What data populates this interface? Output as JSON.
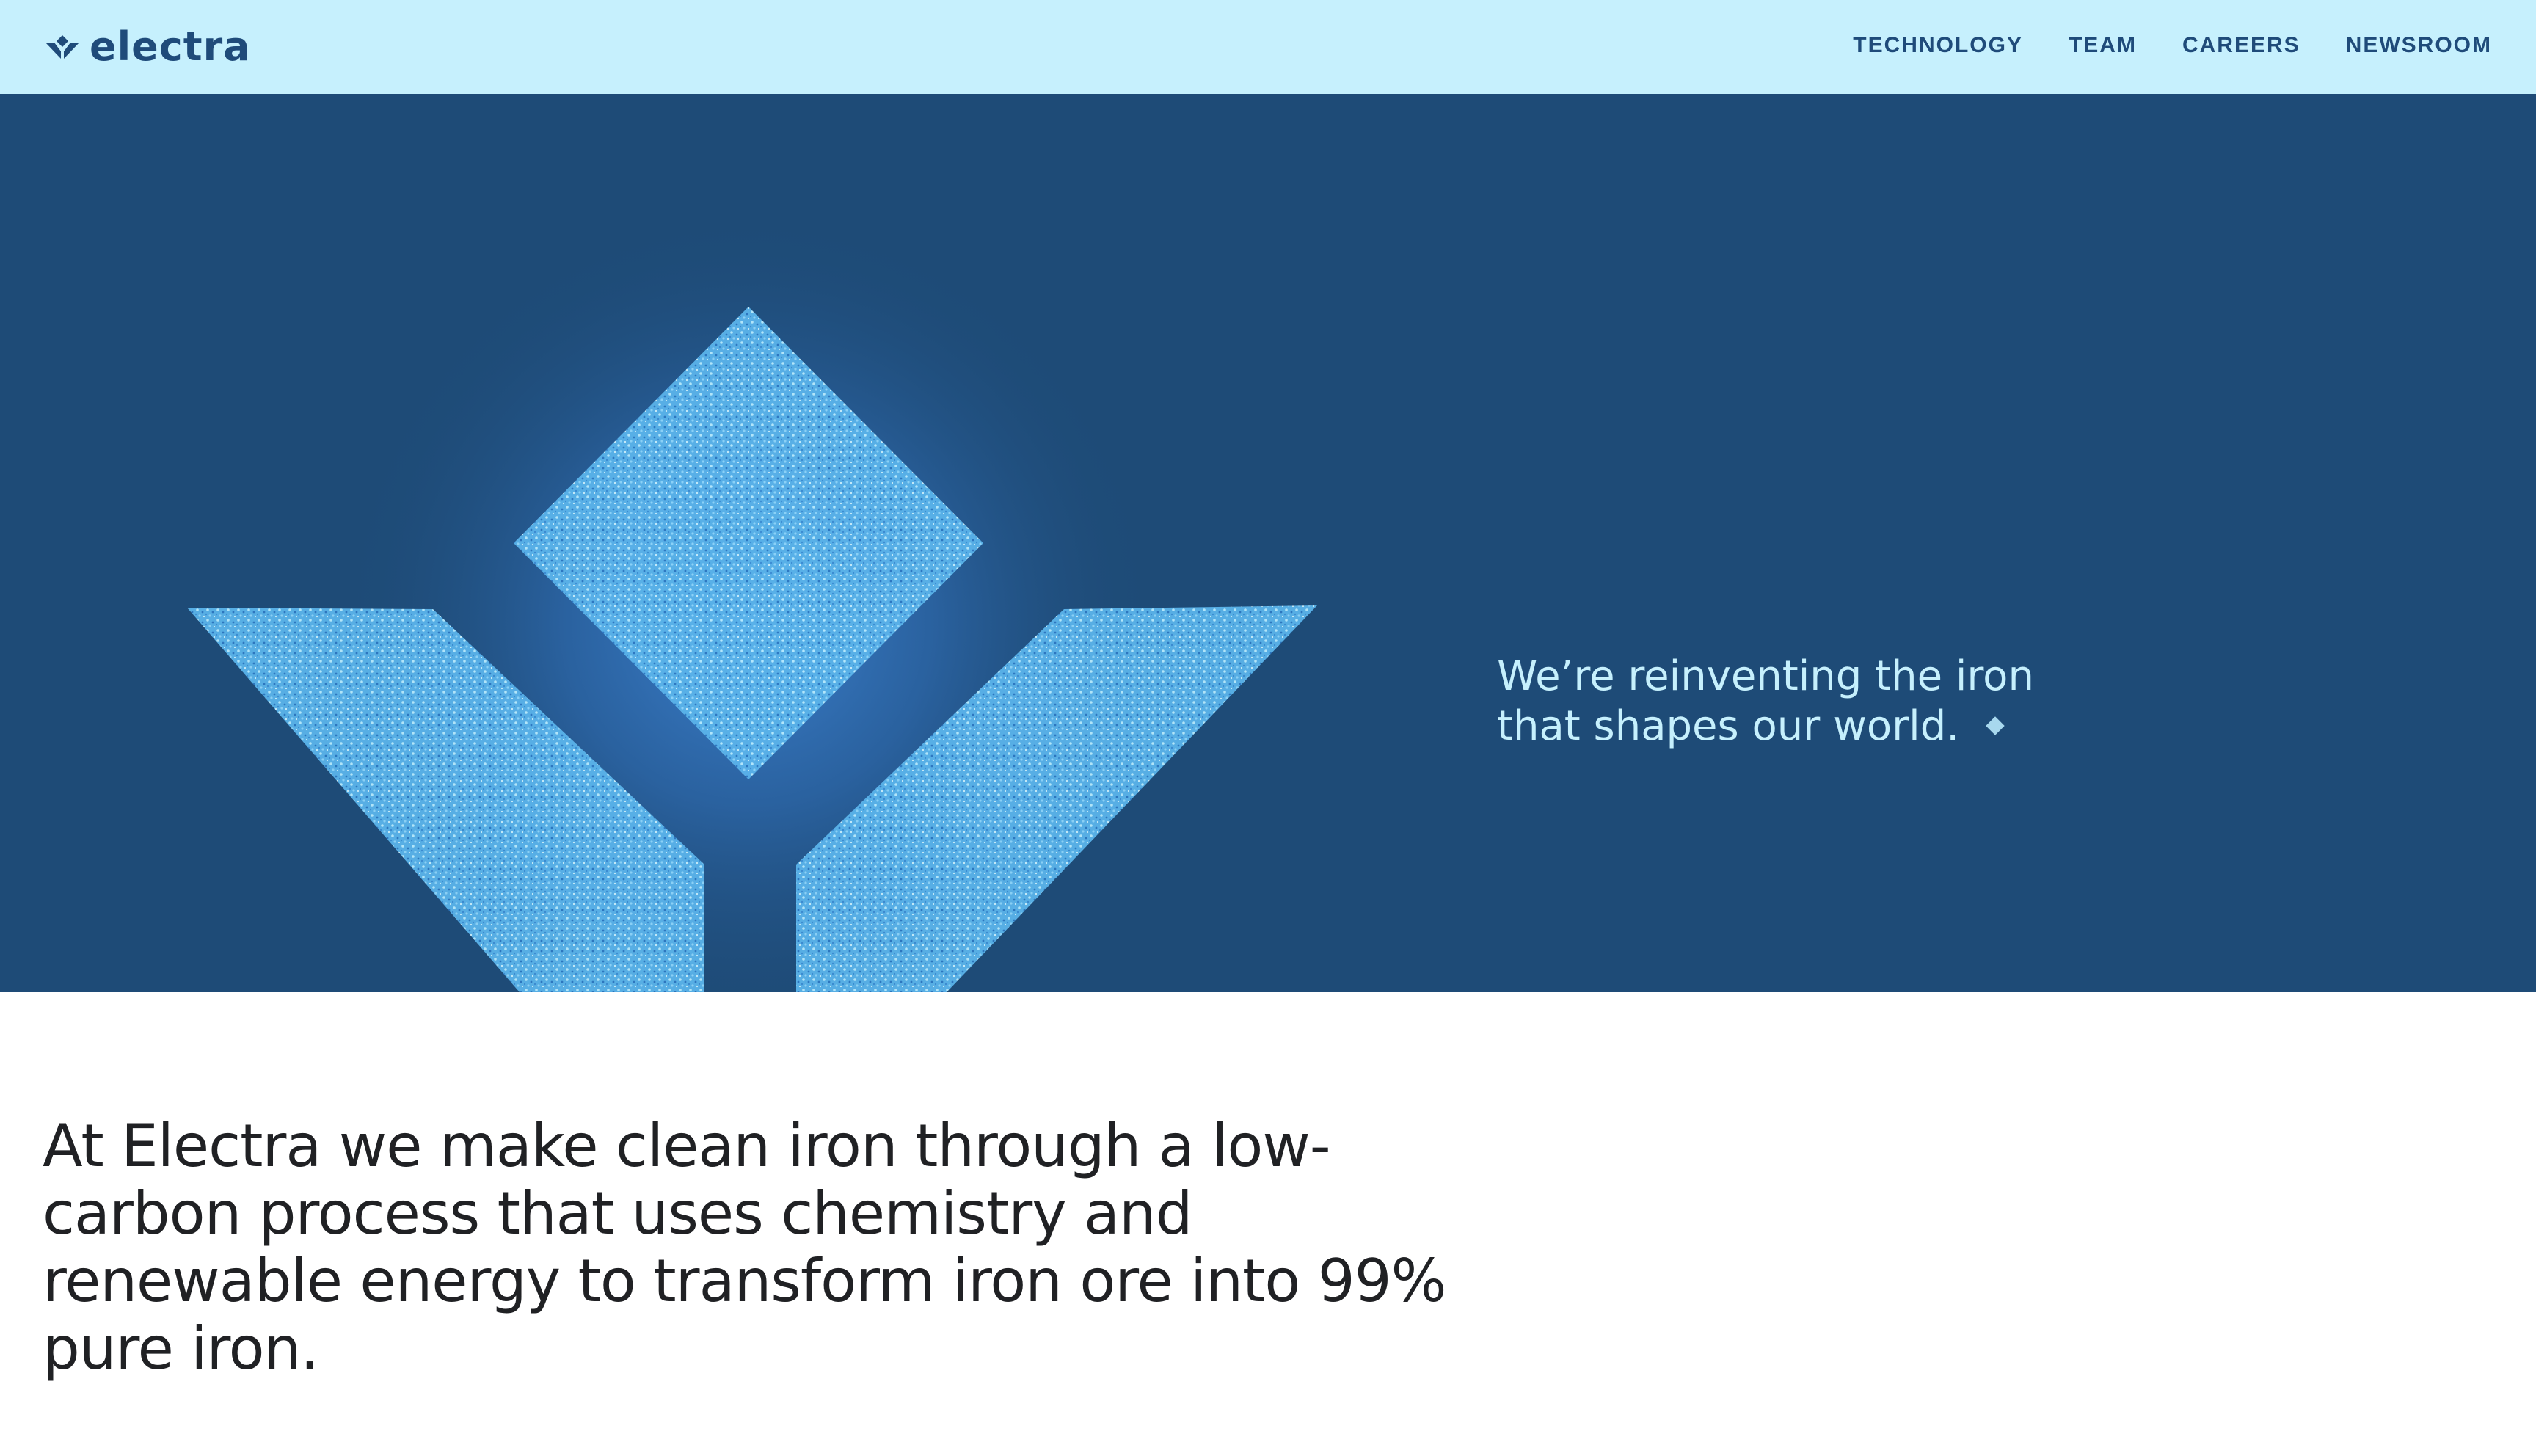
{
  "brand": {
    "name": "electra",
    "logo_icon": "electra-diamond-mark-icon",
    "primary_color": "#1f4b7a",
    "topbar_color": "#c6f0fd",
    "hero_color": "#1e4b77",
    "glow_color": "#3c82d2",
    "particle_color": "#6fc6f3"
  },
  "nav": {
    "items": [
      {
        "label": "TECHNOLOGY"
      },
      {
        "label": "TEAM"
      },
      {
        "label": "CAREERS"
      },
      {
        "label": "NEWSROOM"
      }
    ]
  },
  "hero": {
    "artwork": "particle-diamond-logo-artwork",
    "tagline_lines": [
      "We’re reinventing the iron",
      "that shapes our world."
    ],
    "tagline_icon": "small-diamond-icon"
  },
  "intro": {
    "lines": [
      "At Electra we make clean iron through a low-",
      "carbon process that uses chemistry and",
      "renewable energy to transform iron ore into 99%",
      "pure iron."
    ]
  }
}
